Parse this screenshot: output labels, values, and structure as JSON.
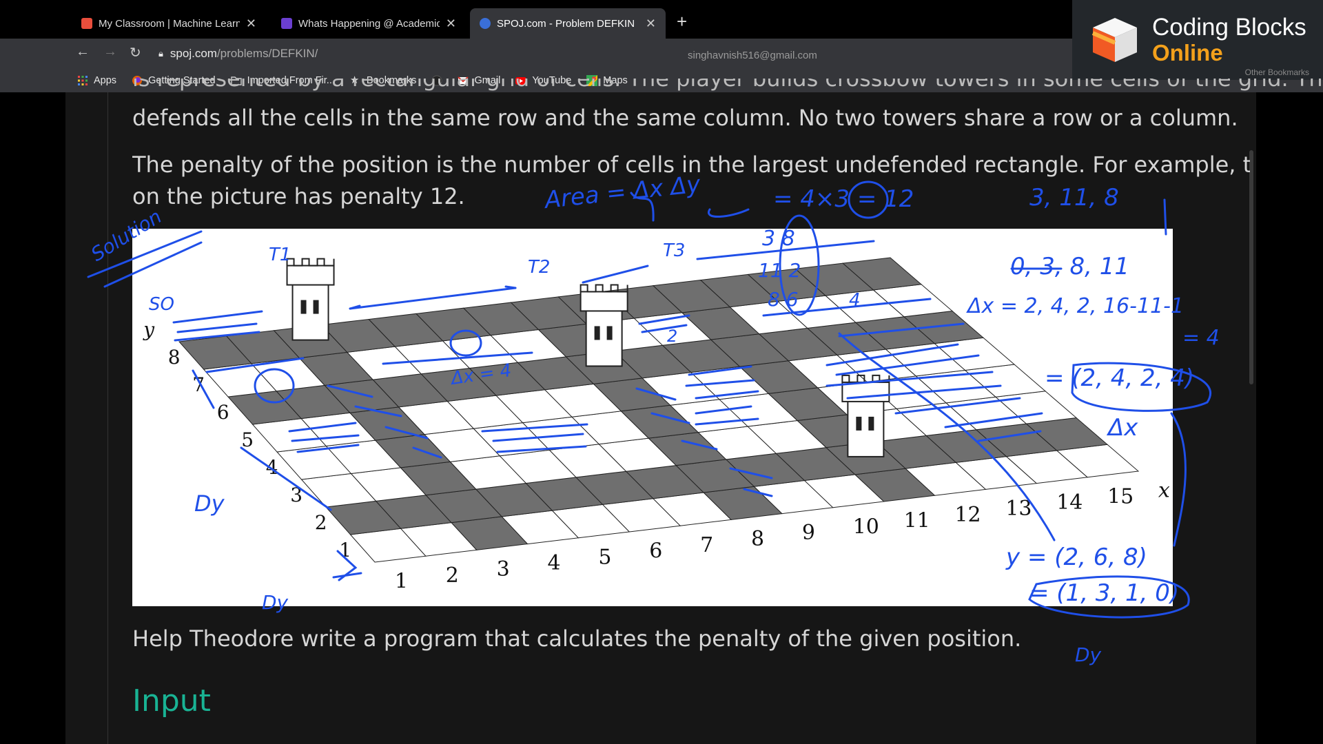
{
  "tabs": [
    {
      "title": "My Classroom | Machine Learn",
      "favicon_color": "#e94e3c"
    },
    {
      "title": "Whats Happening @ Academic",
      "favicon_color": "#6b3fd1"
    },
    {
      "title": "SPOJ.com - Problem DEFKIN",
      "favicon_color": "#3a6fd8",
      "active": true
    }
  ],
  "address": {
    "host": "spoj.com",
    "path": "/problems/DEFKIN/"
  },
  "profile_email": "singhavnish516@gmail.com",
  "bookmarks": [
    {
      "label": "Apps",
      "icon": "apps-grid-icon"
    },
    {
      "label": "Getting Started",
      "icon": "firefox-icon"
    },
    {
      "label": "Imported From Fir...",
      "icon": "folder-icon"
    },
    {
      "label": "Bookmarks",
      "icon": "star-icon"
    },
    {
      "label": "",
      "icon": "github-icon"
    },
    {
      "label": "Gmail",
      "icon": "gmail-icon"
    },
    {
      "label": "YouTube",
      "icon": "youtube-icon"
    },
    {
      "label": "Maps",
      "icon": "maps-icon"
    }
  ],
  "other_bookmarks": "Other Bookmarks",
  "brand": {
    "line1": "Coding Blocks",
    "line2": "Online"
  },
  "content": {
    "cut_line": "is represented by a rectangular grid of cells. The player builds crossbow towers in some cells of the grid. The",
    "line1": "defends all the cells in the same row and the same column. No two towers share a row or a column.",
    "line2": "The penalty of the position is the number of cells in the largest undefended rectangle. For example, the posit",
    "line3": "on the picture has penalty 12.",
    "line4": "Help Theodore write a program that calculates the penalty of the given position.",
    "heading_input": "Input"
  },
  "figure": {
    "x_axis_labels": [
      "1",
      "2",
      "3",
      "4",
      "5",
      "6",
      "7",
      "8",
      "9",
      "10",
      "11",
      "12",
      "13",
      "14",
      "15",
      "x"
    ],
    "y_axis_labels": [
      "1",
      "2",
      "3",
      "4",
      "5",
      "6",
      "7",
      "8",
      "y"
    ]
  },
  "annotations": {
    "area": "Area = Δx Δy",
    "calc": "= 4×3 = 12",
    "x_sorted_raw": "3, 11, 8",
    "x_sorted": "0, 3, 8, 11",
    "dx": "Δx = 2, 4, 2, 16-11-1",
    "dx_note": "= 4",
    "dx_result": "= (2, 4, 2, 4)",
    "dx_label": "Δx",
    "y_vals": "y = (2, 6, 8)",
    "dy_result": "= (1, 3, 1, 0)",
    "dy_label": "Dy",
    "solution": "Solution",
    "so": "SO",
    "t1": "T1",
    "t2": "T2",
    "t3": "T3",
    "stack": [
      "3 8",
      "11 2",
      "8 6"
    ],
    "dx4": "Δx = 4",
    "four": "4",
    "two": "2",
    "dy_left": "Dy",
    "dy_bottom": "Dy",
    "ink_color": "#1f4fe8"
  }
}
